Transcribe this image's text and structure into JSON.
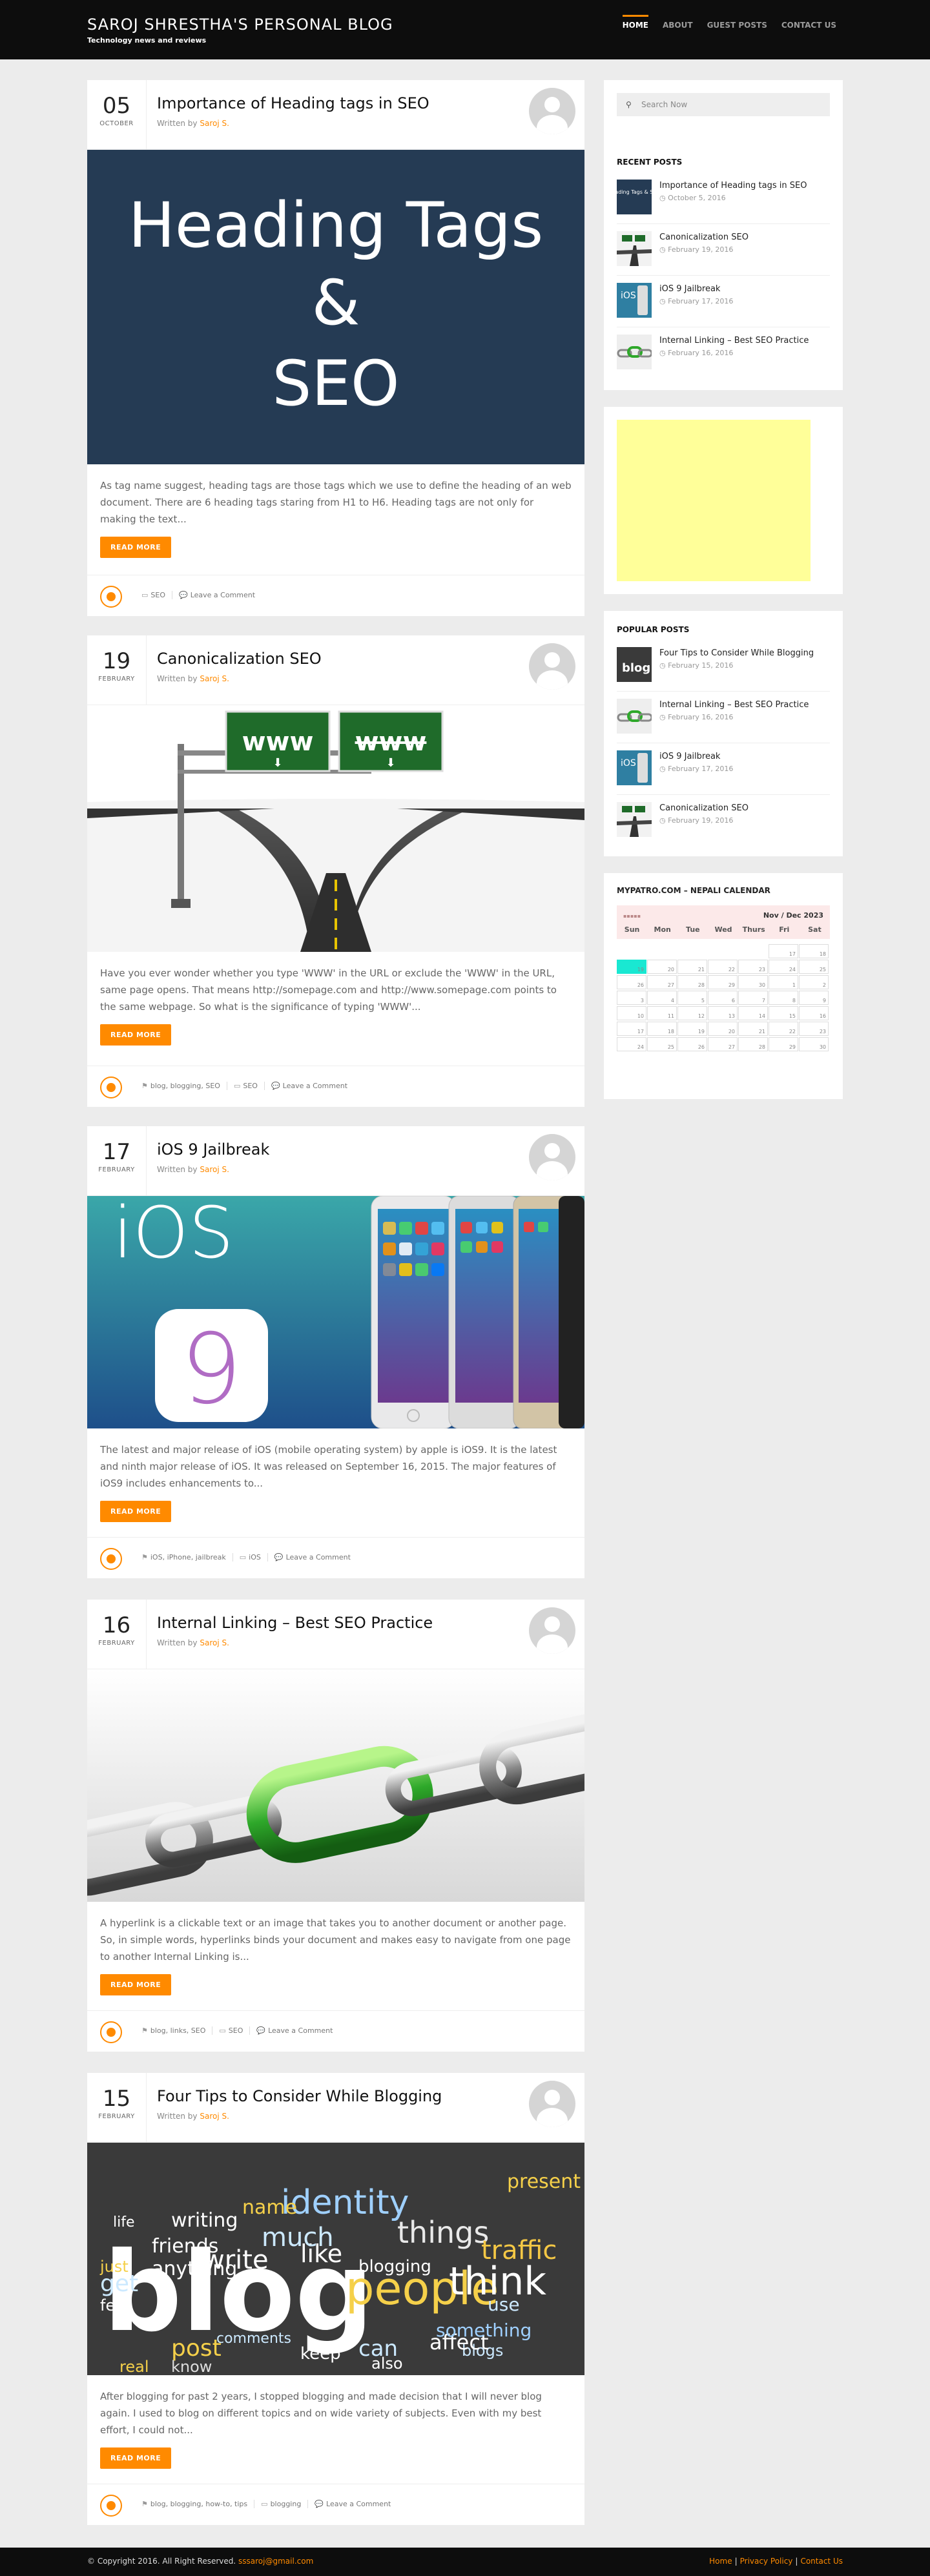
{
  "header": {
    "title": "SAROJ SHRESTHA'S PERSONAL BLOG",
    "tagline": "Technology news and reviews",
    "nav": [
      "HOME",
      "ABOUT",
      "GUEST POSTS",
      "CONTACT US"
    ]
  },
  "common": {
    "written_by": "Written by",
    "author": "Saroj S.",
    "read_more": "READ MORE",
    "comment": "Leave a Comment"
  },
  "posts": [
    {
      "day": "05",
      "month": "OCTOBER",
      "title": "Importance of Heading tags in SEO",
      "image_lines": [
        "Heading Tags",
        "&",
        "SEO"
      ],
      "excerpt": "As tag name suggest, heading tags are those tags which we use to define the heading of an web document. There are 6 heading tags staring from H1 to H6. Heading tags are not only for making the text...",
      "tags": "",
      "category": "SEO"
    },
    {
      "day": "19",
      "month": "FEBRUARY",
      "title": "Canonicalization SEO",
      "image_signs": [
        "www",
        "www"
      ],
      "excerpt": "Have you ever wonder whether you type 'WWW' in the URL or exclude the 'WWW' in the URL, same page opens. That means http://somepage.com and http://www.somepage.com points to the same webpage. So what is the significance of typing 'WWW'...",
      "tags": "blog, blogging, SEO",
      "category": "SEO"
    },
    {
      "day": "17",
      "month": "FEBRUARY",
      "title": "iOS 9 Jailbreak",
      "image_text": "iOS",
      "image_number": "9",
      "excerpt": "The latest and major release of iOS (mobile operating system) by apple is iOS9. It is the latest and ninth major release of iOS. It was released on September 16, 2015. The major features of iOS9 includes enhancements to...",
      "tags": "iOS, iPhone, jailbreak",
      "category": "iOS"
    },
    {
      "day": "16",
      "month": "FEBRUARY",
      "title": "Internal Linking – Best SEO Practice",
      "excerpt": "A hyperlink is a clickable text or an image that takes you to another document or another page. So, in simple words, hyperlinks binds your document and makes easy to navigate from one page to another Internal Linking is...",
      "tags": "blog, links, SEO",
      "category": "SEO"
    },
    {
      "day": "15",
      "month": "FEBRUARY",
      "title": "Four Tips to Consider While Blogging",
      "image_words": [
        "blog",
        "people",
        "think",
        "things",
        "traffic",
        "write",
        "identity",
        "like",
        "post",
        "blogging",
        "present",
        "writing",
        "comments",
        "know",
        "keep",
        "real",
        "friends",
        "anything",
        "get",
        "can",
        "also",
        "name",
        "much",
        "life",
        "just",
        "feel",
        "blogs",
        "affect",
        "use",
        "something"
      ],
      "excerpt": "After blogging for past 2 years, I stopped blogging and made decision that I will never blog again. I used to blog on different topics and on wide variety of subjects. Even with my best effort, I could not...",
      "tags": "blog, blogging, how-to, tips",
      "category": "blogging"
    }
  ],
  "sidebar": {
    "search_placeholder": "Search Now",
    "recent_title": "RECENT POSTS",
    "recent": [
      {
        "title": "Importance of Heading tags in SEO",
        "date": "October 5, 2016",
        "thumb": "heading"
      },
      {
        "title": "Canonicalization SEO",
        "date": "February 19, 2016",
        "thumb": "road"
      },
      {
        "title": "iOS 9 Jailbreak",
        "date": "February 17, 2016",
        "thumb": "ios"
      },
      {
        "title": "Internal Linking – Best SEO Practice",
        "date": "February 16, 2016",
        "thumb": "chain"
      }
    ],
    "popular_title": "POPULAR POSTS",
    "popular": [
      {
        "title": "Four Tips to Consider While Blogging",
        "date": "February 15, 2016",
        "thumb": "blog"
      },
      {
        "title": "Internal Linking – Best SEO Practice",
        "date": "February 16, 2016",
        "thumb": "chain"
      },
      {
        "title": "iOS 9 Jailbreak",
        "date": "February 17, 2016",
        "thumb": "ios"
      },
      {
        "title": "Canonicalization SEO",
        "date": "February 19, 2016",
        "thumb": "road"
      }
    ],
    "thumb_labels": {
      "heading": "Heading Tags & SEO",
      "ios": "iOS"
    },
    "calendar_title": "MYPATRO.COM – NEPALI CALENDAR",
    "calendar": {
      "month": "Nov / Dec 2023",
      "days": [
        "Sun",
        "Mon",
        "Tue",
        "Wed",
        "Thurs",
        "Fri",
        "Sat"
      ],
      "first_col": 5,
      "start": 17,
      "count": 44,
      "month_days": 30,
      "today": 19
    }
  },
  "footer": {
    "copyright": "© Copyright 2016. All Right Reserved.",
    "email": "sssaroj@gmail.com",
    "links": [
      "Home",
      "Privacy Policy",
      "Contact Us"
    ]
  },
  "colors": {
    "accent": "#ff8a00",
    "header_bg": "#0d0d0d",
    "page_bg": "#ececec",
    "ad_bg": "#ffff99",
    "calendar_today": "#19e8d2",
    "heading_image_bg": "#253b54"
  }
}
